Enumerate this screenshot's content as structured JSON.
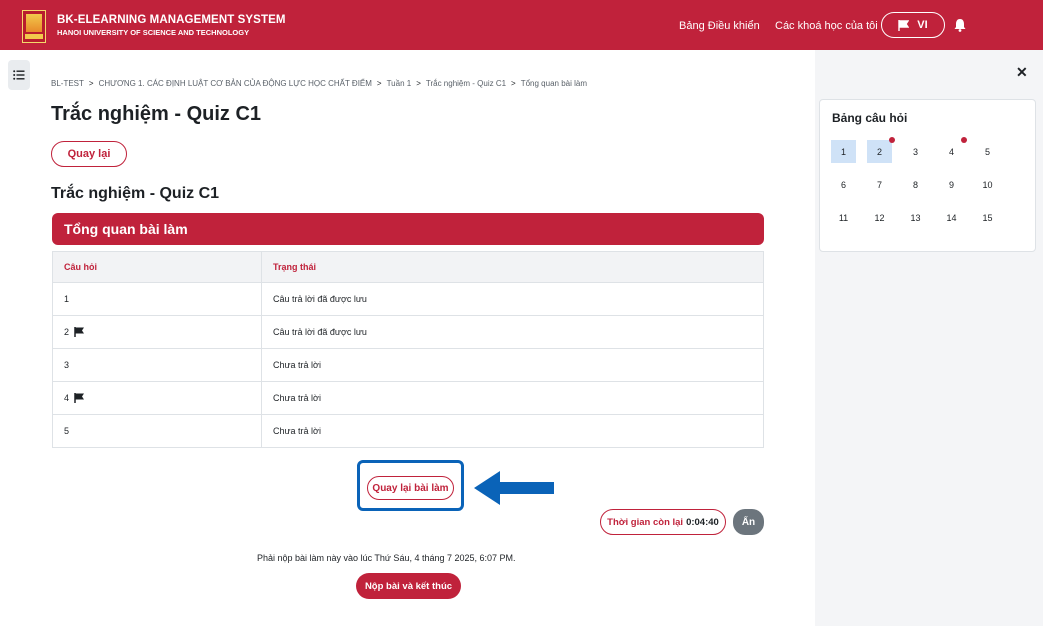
{
  "header": {
    "brand_title": "BK-ELEARNING MANAGEMENT SYSTEM",
    "brand_subtitle": "HANOI UNIVERSITY OF SCIENCE AND TECHNOLOGY",
    "nav_dashboard": "Bảng Điều khiển",
    "nav_my_courses": "Các khoá học của tôi",
    "lang": "VI",
    "brand_color": "#c0223b"
  },
  "breadcrumb": [
    "BL-TEST",
    "CHƯƠNG 1. CÁC ĐỊNH LUẬT CƠ BẢN CỦA ĐỘNG LỰC HỌC CHẤT ĐIỂM",
    "Tuần 1",
    "Trắc nghiệm - Quiz C1",
    "Tổng quan bài làm"
  ],
  "page": {
    "title": "Trắc nghiệm - Quiz C1",
    "back_label": "Quay lại",
    "section_title": "Trắc nghiệm - Quiz C1",
    "summary_title": "Tổng quan bài làm"
  },
  "table": {
    "headers": [
      "Câu hỏi",
      "Trạng thái"
    ],
    "rows": [
      {
        "q": "1",
        "status": "Câu trả lời đã được lưu",
        "flagged": false
      },
      {
        "q": "2",
        "status": "Câu trả lời đã được lưu",
        "flagged": true
      },
      {
        "q": "3",
        "status": "Chưa trả lời",
        "flagged": false
      },
      {
        "q": "4",
        "status": "Chưa trả lời",
        "flagged": true
      },
      {
        "q": "5",
        "status": "Chưa trả lời",
        "flagged": false
      }
    ]
  },
  "actions": {
    "return_label": "Quay lại bài làm",
    "timer_label": "Thời gian còn lại",
    "timer_value": "0:04:40",
    "hide_label": "Ẩn",
    "deadline_text": "Phải nộp bài làm này vào lúc Thứ Sáu, 4 tháng 7 2025, 6:07 PM.",
    "submit_label": "Nộp bài và kết thúc"
  },
  "quiz_nav": {
    "title": "Bảng câu hỏi",
    "questions": [
      {
        "n": "1",
        "answered": true,
        "flagged": false
      },
      {
        "n": "2",
        "answered": true,
        "flagged": true
      },
      {
        "n": "3",
        "answered": false,
        "flagged": false
      },
      {
        "n": "4",
        "answered": false,
        "flagged": true
      },
      {
        "n": "5",
        "answered": false,
        "flagged": false
      },
      {
        "n": "6",
        "answered": false,
        "flagged": false
      },
      {
        "n": "7",
        "answered": false,
        "flagged": false
      },
      {
        "n": "8",
        "answered": false,
        "flagged": false
      },
      {
        "n": "9",
        "answered": false,
        "flagged": false
      },
      {
        "n": "10",
        "answered": false,
        "flagged": false
      },
      {
        "n": "11",
        "answered": false,
        "flagged": false
      },
      {
        "n": "12",
        "answered": false,
        "flagged": false
      },
      {
        "n": "13",
        "answered": false,
        "flagged": false
      },
      {
        "n": "14",
        "answered": false,
        "flagged": false
      },
      {
        "n": "15",
        "answered": false,
        "flagged": false
      }
    ]
  }
}
